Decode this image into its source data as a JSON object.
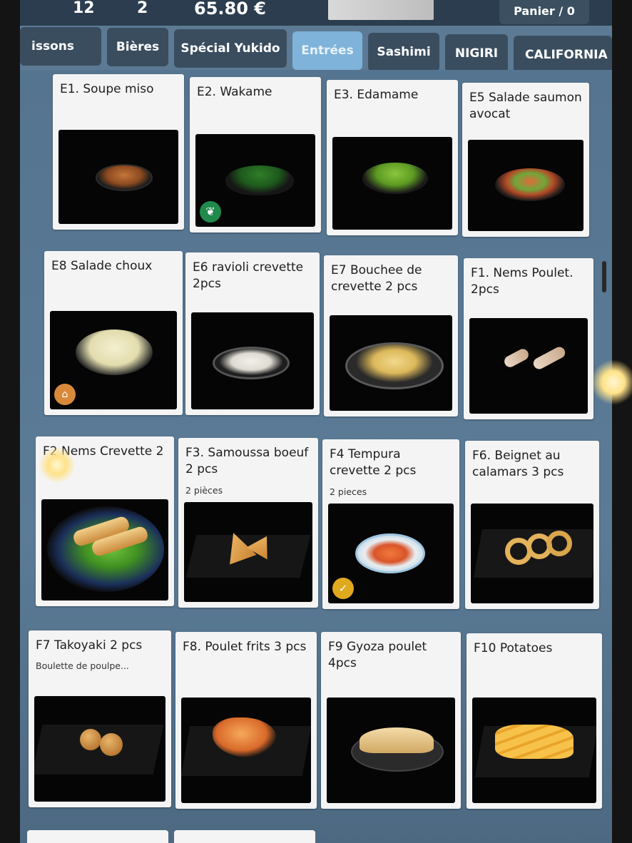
{
  "header": {
    "count_a": "12",
    "count_b": "2",
    "total": "65.80 €",
    "cart_label": "Panier / 0"
  },
  "tabs": [
    {
      "label": "issons"
    },
    {
      "label": "Bières"
    },
    {
      "label": "Spécial Yukido"
    },
    {
      "label": "Entrées",
      "active": true
    },
    {
      "label": "Sashimi"
    },
    {
      "label": "NIGIRI"
    },
    {
      "label": "CALIFORNIA"
    }
  ],
  "items": [
    {
      "title": "E1. Soupe miso",
      "subtitle": "",
      "icon": "miso-bowl"
    },
    {
      "title": "E2. Wakame",
      "subtitle": "",
      "icon": "seaweed-bowl",
      "badge": "vegetarian-icon"
    },
    {
      "title": "E3. Edamame",
      "subtitle": "",
      "icon": "edamame-bowl"
    },
    {
      "title": "E5 Salade saumon avocat",
      "subtitle": "",
      "icon": "salmon-salad-bowl"
    },
    {
      "title": "E8 Salade choux",
      "subtitle": "",
      "icon": "cabbage-salad-bowl",
      "badge": "homemade-icon"
    },
    {
      "title": "E6 ravioli crevette 2pcs",
      "subtitle": "",
      "icon": "ravioli-plate"
    },
    {
      "title": "E7 Bouchee de crevette 2 pcs",
      "subtitle": "",
      "icon": "dumpling-plate"
    },
    {
      "title": "F1. Nems Poulet. 2pcs",
      "subtitle": "",
      "icon": "spring-rolls"
    },
    {
      "title": "F2 Nems Crevette 2",
      "subtitle": "",
      "icon": "shrimp-nems-plate"
    },
    {
      "title": "F3. Samoussa boeuf 2 pcs",
      "subtitle": "2 pièces",
      "icon": "samosa"
    },
    {
      "title": "F4 Tempura crevette 2 pcs",
      "subtitle": "2 pieces",
      "icon": "tempura-plate",
      "badge": "award-icon"
    },
    {
      "title": "F6. Beignet au calamars 3 pcs",
      "subtitle": "",
      "icon": "calamari-rings"
    },
    {
      "title": "F7 Takoyaki 2 pcs",
      "subtitle": "Boulette de poulpe...",
      "icon": "takoyaki"
    },
    {
      "title": "F8. Poulet frits 3 pcs",
      "subtitle": "",
      "icon": "fried-chicken"
    },
    {
      "title": "F9 Gyoza poulet 4pcs",
      "subtitle": "",
      "icon": "gyoza-plate"
    },
    {
      "title": "F10 Potatoes",
      "subtitle": "",
      "icon": "potatoes"
    }
  ],
  "colors": {
    "background": "#5c7a94",
    "tab": "#3a4d5f",
    "tab_active": "#7fb3d9",
    "card": "#f4f4f4",
    "photo": "#050505"
  }
}
